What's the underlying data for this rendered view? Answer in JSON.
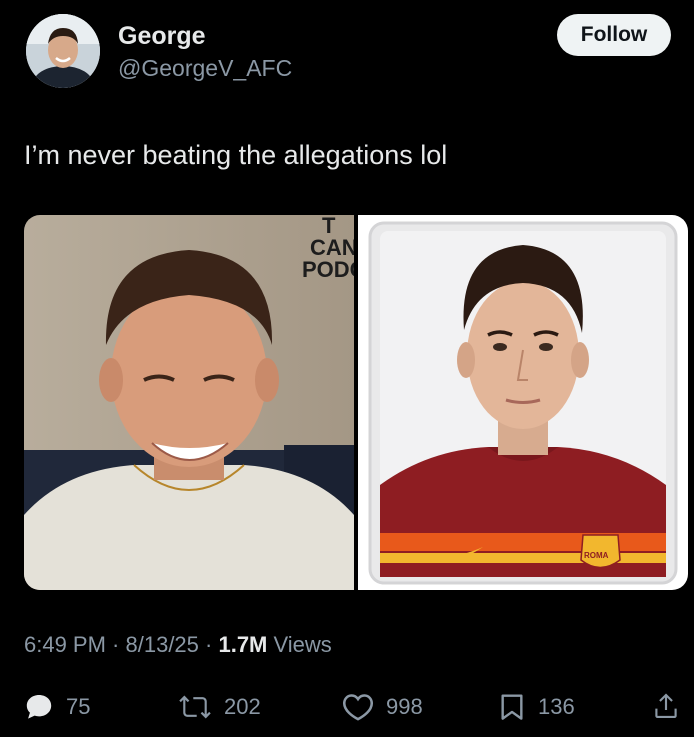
{
  "author": {
    "name": "George",
    "handle": "@GeorgeV_AFC",
    "avatar_icon": "user-avatar"
  },
  "follow_label": "Follow",
  "tweet": {
    "text": "I’m never beating the allegations lol"
  },
  "media": {
    "left_overlay_text": [
      "T",
      "CAN",
      "PODC"
    ],
    "right_badge_text": "ROMA"
  },
  "meta": {
    "time": "6:49 PM",
    "separator": " · ",
    "date": "8/13/25",
    "views_count": "1.7M",
    "views_label": " Views"
  },
  "actions": {
    "replies": "75",
    "reposts": "202",
    "likes": "998",
    "bookmarks": "136"
  },
  "colors": {
    "background": "#000000",
    "text_primary": "#e7e9ea",
    "text_secondary": "#8b98a5",
    "follow_bg": "#eff3f4"
  }
}
